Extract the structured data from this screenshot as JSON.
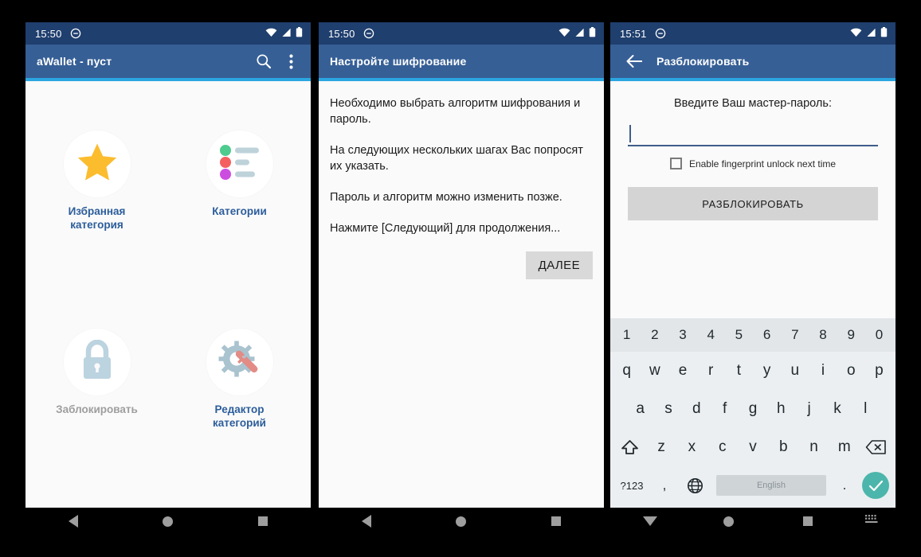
{
  "panels": {
    "home": {
      "status": {
        "time": "15:50"
      },
      "appbar": {
        "title": "aWallet - пуст"
      },
      "tiles": [
        {
          "label": "Избранная категория",
          "icon": "star-icon",
          "muted": false
        },
        {
          "label": "Категории",
          "icon": "list-icon",
          "muted": false
        },
        {
          "label": "Заблокировать",
          "icon": "lock-icon",
          "muted": true
        },
        {
          "label": "Редактор категорий",
          "icon": "gear-wrench-icon",
          "muted": false
        }
      ]
    },
    "wizard": {
      "status": {
        "time": "15:50"
      },
      "appbar": {
        "title": "Настройте шифрование"
      },
      "paragraphs": [
        "Необходимо выбрать алгоритм шифрования и пароль.",
        "На следующих нескольких шагах Вас попросят их указать.",
        "Пароль и алгоритм можно изменить позже.",
        "Нажмите [Следующий] для продолжения..."
      ],
      "next_button": "ДАЛЕЕ"
    },
    "unlock": {
      "status": {
        "time": "15:51"
      },
      "appbar": {
        "title": "Разблокировать"
      },
      "prompt": "Введите Ваш мастер-пароль:",
      "password_value": "",
      "password_placeholder": "",
      "fingerprint_label": "Enable fingerprint unlock next time",
      "fingerprint_checked": false,
      "unlock_button": "РАЗБЛОКИРОВАТЬ",
      "keyboard": {
        "numbers": [
          "1",
          "2",
          "3",
          "4",
          "5",
          "6",
          "7",
          "8",
          "9",
          "0"
        ],
        "row1": [
          "q",
          "w",
          "e",
          "r",
          "t",
          "y",
          "u",
          "i",
          "o",
          "p"
        ],
        "row2": [
          "a",
          "s",
          "d",
          "f",
          "g",
          "h",
          "j",
          "k",
          "l"
        ],
        "row3": [
          "z",
          "x",
          "c",
          "v",
          "b",
          "n",
          "m"
        ],
        "shift_icon": "shift-icon",
        "backspace_icon": "backspace-icon",
        "symbols_key": "?123",
        "comma_key": ",",
        "globe_icon": "globe-icon",
        "space_label": "English",
        "period_key": ".",
        "enter_icon": "check-icon"
      }
    }
  },
  "navbar": {
    "back_icon": "back-triangle-icon",
    "home_icon": "home-circle-icon",
    "recents_icon": "recents-square-icon",
    "hide_keyboard_icon": "hide-keyboard-icon",
    "keyboard_switch_icon": "keyboard-switcher-icon"
  },
  "colors": {
    "status_bar": "#1f3f6e",
    "app_bar": "#365f96",
    "accent_line": "#2ba6e0",
    "link_blue": "#2c5d9b",
    "muted_gray": "#9e9e9e",
    "star_yellow": "#fbbc2e",
    "lock_blue_gray": "#b9d0dd",
    "wrench_red": "#e38b85",
    "gear_gray": "#a9c3cf",
    "enter_teal": "#4db6ac",
    "keyboard_bg": "#eceff1"
  }
}
